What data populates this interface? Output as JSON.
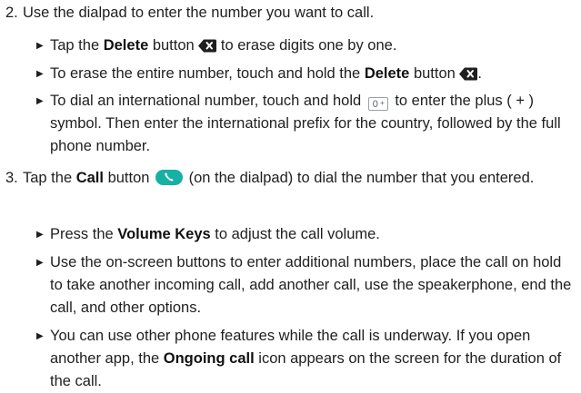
{
  "step2": {
    "number": "2.",
    "text": "Use the dialpad to enter the number you want to call.",
    "bullets": {
      "b1": {
        "pre": "Tap the ",
        "bold": "Delete",
        "mid": " button ",
        "post": " to erase digits one by one."
      },
      "b2": {
        "pre": "To erase the entire number, touch and hold the ",
        "bold": "Delete",
        "mid": " button ",
        "post": "."
      },
      "b3": {
        "pre": "To dial an international number, touch and hold ",
        "key_zero": "0",
        "key_plus": "+",
        "post": " to enter the plus ( + ) symbol. Then enter the international prefix for the country, followed by the full phone number."
      }
    }
  },
  "step3": {
    "number": "3.",
    "pre": "Tap the ",
    "bold": "Call",
    "mid": " button ",
    "post": " (on the dialpad) to dial the number that you entered.",
    "bullets": {
      "b1": {
        "pre": "Press the ",
        "bold": "Volume Keys",
        "post": " to adjust the call volume."
      },
      "b2": {
        "text": "Use the on-screen buttons to enter additional numbers, place the call on hold to take another incoming call, add another call, use the speakerphone, end the call, and other options."
      },
      "b3": {
        "pre": "You can use other phone features while the call is underway. If you open another app, the ",
        "bold": "Ongoing call",
        "post": " icon appears on the screen for the duration of the call."
      }
    }
  },
  "icons": {
    "delete": "backspace-delete-icon",
    "call": "phone-handset-icon",
    "bullet": "triangle-right-icon"
  },
  "colors": {
    "text": "#1f1f1f",
    "call_button": "#17b0a4",
    "delete_icon": "#1f1f1f"
  }
}
